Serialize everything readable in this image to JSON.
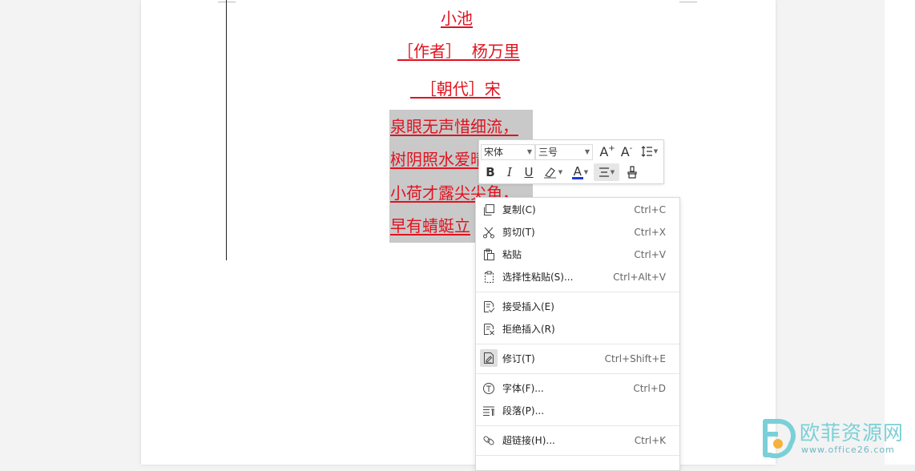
{
  "document": {
    "lines": [
      "小池",
      "［作者］  杨万里",
      "  ［朝代］宋",
      "泉眼无声惜细流，",
      "树阴照水爱晴",
      "小荷才露尖尖角，",
      "早有蜻蜓立"
    ],
    "text_color": "#e0121f",
    "selection_color": "#c9c9c9"
  },
  "mini_toolbar": {
    "font_name": "宋体",
    "font_size": "三号",
    "icons": [
      "grow-font-icon",
      "shrink-font-icon",
      "line-spacing-icon",
      "bold-icon",
      "italic-icon",
      "underline-icon",
      "highlight-icon",
      "font-color-icon",
      "align-icon",
      "format-painter-icon"
    ],
    "bold_glyph": "B",
    "italic_glyph": "I",
    "underline_glyph": "U",
    "font_color_glyph": "A",
    "grow_glyph": "A",
    "shrink_glyph": "A",
    "font_color": "#1a3ad8"
  },
  "context_menu": {
    "items": [
      {
        "label": "复制(C)",
        "shortcut": "Ctrl+C",
        "icon": "copy-icon"
      },
      {
        "label": "剪切(T)",
        "shortcut": "Ctrl+X",
        "icon": "cut-icon"
      },
      {
        "label": "粘贴",
        "shortcut": "Ctrl+V",
        "icon": "paste-icon"
      },
      {
        "label": "选择性粘贴(S)...",
        "shortcut": "Ctrl+Alt+V",
        "icon": "paste-special-icon"
      },
      {
        "label": "接受插入(E)",
        "shortcut": "",
        "icon": "accept-insert-icon"
      },
      {
        "label": "拒绝插入(R)",
        "shortcut": "",
        "icon": "reject-insert-icon"
      },
      {
        "label": "修订(T)",
        "shortcut": "Ctrl+Shift+E",
        "icon": "track-changes-icon",
        "checked": true
      },
      {
        "label": "字体(F)...",
        "shortcut": "Ctrl+D",
        "icon": "font-icon"
      },
      {
        "label": "段落(P)...",
        "shortcut": "",
        "icon": "paragraph-icon"
      },
      {
        "label": "超链接(H)...",
        "shortcut": "Ctrl+K",
        "icon": "hyperlink-icon"
      }
    ]
  },
  "watermark": {
    "title": "欧菲资源网",
    "url": "www.office26.com",
    "color": "#7ad0d8"
  }
}
